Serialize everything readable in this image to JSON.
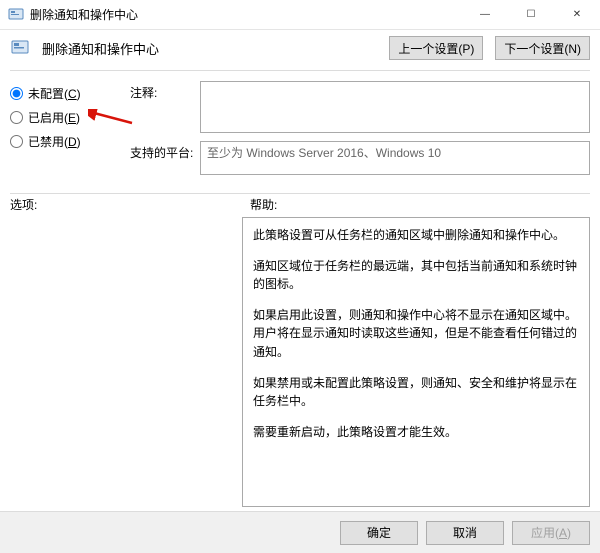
{
  "window": {
    "title": "删除通知和操作中心",
    "min_label": "—",
    "max_label": "☐",
    "close_label": "✕"
  },
  "header": {
    "title": "删除通知和操作中心",
    "prev_label": "上一个设置(P)",
    "next_label": "下一个设置(N)"
  },
  "radios": {
    "not_configured_prefix": "未配置(",
    "not_configured_key": "C",
    "not_configured_suffix": ")",
    "enabled_prefix": "已启用(",
    "enabled_key": "E",
    "enabled_suffix": ")",
    "disabled_prefix": "已禁用(",
    "disabled_key": "D",
    "disabled_suffix": ")",
    "selected": "not_configured"
  },
  "fields": {
    "comment_label": "注释:",
    "comment_value": "",
    "platform_label": "支持的平台:",
    "platform_value": "至少为 Windows Server 2016、Windows 10"
  },
  "sections": {
    "options_label": "选项:",
    "help_label": "帮助:"
  },
  "help": {
    "p1": "此策略设置可从任务栏的通知区域中删除通知和操作中心。",
    "p2": "通知区域位于任务栏的最远端，其中包括当前通知和系统时钟的图标。",
    "p3": "如果启用此设置，则通知和操作中心将不显示在通知区域中。用户将在显示通知时读取这些通知，但是不能查看任何错过的通知。",
    "p4": "如果禁用或未配置此策略设置，则通知、安全和维护将显示在任务栏中。",
    "p5": "需要重新启动，此策略设置才能生效。"
  },
  "buttons": {
    "ok": "确定",
    "cancel": "取消",
    "apply_prefix": "应用(",
    "apply_key": "A",
    "apply_suffix": ")"
  }
}
